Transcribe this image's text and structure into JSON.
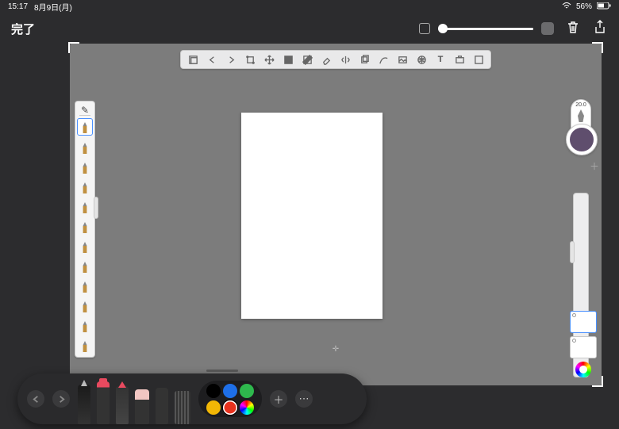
{
  "status": {
    "time": "15:17",
    "date": "8月9日(月)",
    "battery": "56%"
  },
  "nav": {
    "done": "完了"
  },
  "brush": {
    "size_value": "20.0",
    "current_color": "#5f4e6d"
  },
  "toolbar_icons": [
    "layers",
    "undo",
    "redo",
    "transform",
    "move",
    "fill",
    "gradient",
    "eraser",
    "symmetry",
    "copy",
    "curve",
    "image",
    "grid",
    "text",
    "ref",
    "fullscreen"
  ],
  "brush_presets": 12,
  "palette": [
    {
      "c": "#000000",
      "sel": false
    },
    {
      "c": "#1e6fe8",
      "sel": false
    },
    {
      "c": "#2eb84d",
      "sel": false
    },
    {
      "c": "#f2b705",
      "sel": false
    },
    {
      "c": "#e8321e",
      "sel": true
    },
    {
      "c": "rainbow",
      "sel": false
    }
  ],
  "markup_tools": [
    "pen",
    "marker",
    "pencil",
    "eraser",
    "lasso",
    "ruler"
  ],
  "text_tool_label": "T"
}
